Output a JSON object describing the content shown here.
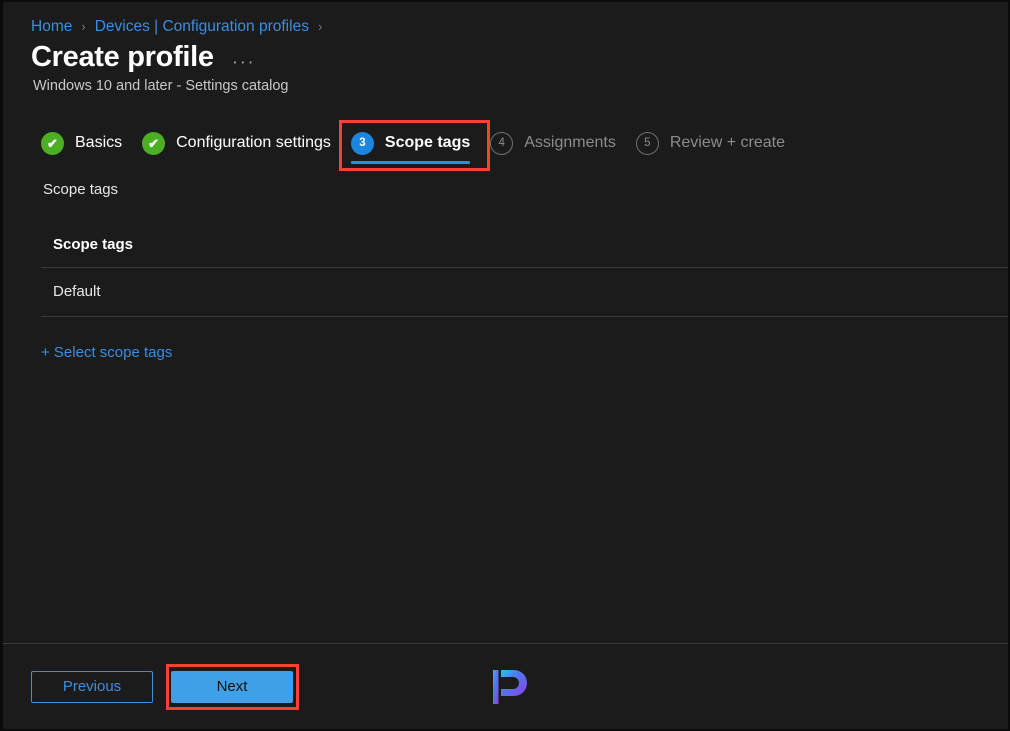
{
  "breadcrumb": {
    "items": [
      {
        "label": "Home",
        "separator": "›"
      },
      {
        "label": "Devices | Configuration profiles",
        "separator": "›"
      }
    ],
    "link_color": "#3b8ee0"
  },
  "header": {
    "title": "Create profile",
    "more_actions": "···",
    "subtitle": "Windows 10 and later - Settings catalog"
  },
  "wizard": {
    "steps": [
      {
        "number": "1",
        "label": "Basics",
        "state": "done",
        "badge_glyph": "✔"
      },
      {
        "number": "2",
        "label": "Configuration settings",
        "state": "done",
        "badge_glyph": "✔"
      },
      {
        "number": "3",
        "label": "Scope tags",
        "state": "current",
        "badge_glyph": "3"
      },
      {
        "number": "4",
        "label": "Assignments",
        "state": "todo",
        "badge_glyph": "4"
      },
      {
        "number": "5",
        "label": "Review + create",
        "state": "todo",
        "badge_glyph": "5"
      }
    ],
    "done_color": "#4caf23",
    "current_color": "#1b86e0",
    "todo_color": "#8c8c8c",
    "highlight_color": "#f4442e"
  },
  "main": {
    "section_label": "Scope tags",
    "table": {
      "columns": [
        "Scope tags"
      ],
      "rows": [
        [
          "Default"
        ]
      ]
    },
    "select_scope_tags_link": "+ Select scope tags"
  },
  "footer": {
    "previous_label": "Previous",
    "next_label": "Next",
    "primary_color": "#3fa0e8",
    "logo_name": "prajwal-desai-p-logo"
  }
}
